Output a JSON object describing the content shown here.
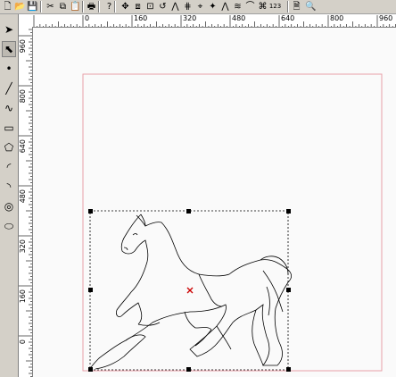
{
  "toolbar": {
    "items": [
      {
        "name": "new-file-icon",
        "glyph": "🗋"
      },
      {
        "name": "open-file-icon",
        "glyph": "📂"
      },
      {
        "name": "save-file-icon",
        "glyph": "💾"
      },
      {
        "name": "cut-icon",
        "glyph": "✂"
      },
      {
        "name": "copy-icon",
        "glyph": "⧉"
      },
      {
        "name": "paste-icon",
        "glyph": "📋"
      },
      {
        "name": "print-icon",
        "glyph": "🖶"
      },
      {
        "name": "help-icon",
        "glyph": "?"
      },
      {
        "name": "move-icon",
        "glyph": "✥"
      },
      {
        "name": "mirror-icon",
        "glyph": "⧈"
      },
      {
        "name": "scale-icon",
        "glyph": "⊡"
      },
      {
        "name": "rotate-icon",
        "glyph": "↺"
      },
      {
        "name": "flip-icon",
        "glyph": "⋀"
      },
      {
        "name": "array-icon",
        "glyph": "⋕"
      },
      {
        "name": "node-icon",
        "glyph": "⌖"
      },
      {
        "name": "origin-icon",
        "glyph": "✦"
      },
      {
        "name": "warp-icon",
        "glyph": "⋀"
      },
      {
        "name": "fill-icon",
        "glyph": "≋"
      },
      {
        "name": "weld-icon",
        "glyph": "⌒"
      },
      {
        "name": "trace-icon",
        "glyph": "⌘"
      },
      {
        "name": "number-icon",
        "glyph": "123"
      },
      {
        "name": "page-icon",
        "glyph": "🗎"
      },
      {
        "name": "zoom-icon",
        "glyph": "🔍"
      }
    ]
  },
  "left_tools": [
    {
      "name": "select-arrow-icon",
      "glyph": "➤"
    },
    {
      "name": "node-select-icon",
      "glyph": "⬉"
    },
    {
      "name": "point-icon",
      "glyph": "•"
    },
    {
      "name": "line-icon",
      "glyph": "╱"
    },
    {
      "name": "curve-icon",
      "glyph": "∿"
    },
    {
      "name": "rectangle-icon",
      "glyph": "▭"
    },
    {
      "name": "polygon-icon",
      "glyph": "⬠"
    },
    {
      "name": "arc-icon",
      "glyph": "◜"
    },
    {
      "name": "arc2-icon",
      "glyph": "◝"
    },
    {
      "name": "circle-center-icon",
      "glyph": "◎"
    },
    {
      "name": "ellipse-icon",
      "glyph": "⬭"
    }
  ],
  "hruler": {
    "labels": [
      "0",
      "160",
      "320",
      "480",
      "640",
      "800",
      "960"
    ]
  },
  "vruler": {
    "labels": [
      "960",
      "800",
      "640",
      "480",
      "320",
      "160",
      "0"
    ]
  },
  "colors": {
    "page_border": "#e8a0a8",
    "selection_marker": "#cc0000",
    "handle": "#000000"
  }
}
